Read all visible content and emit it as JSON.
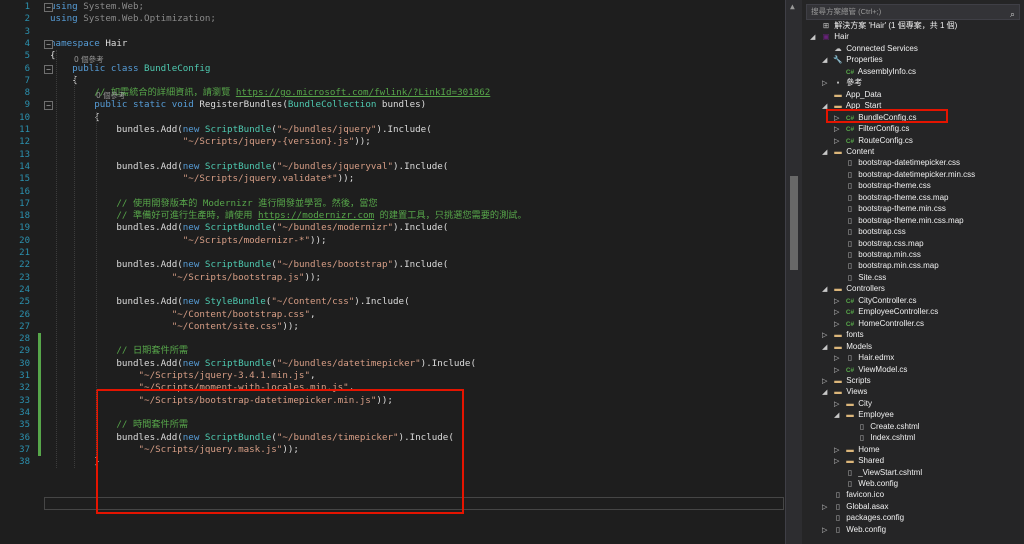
{
  "editor": {
    "line_numbers": [
      "1",
      "2",
      "3",
      "4",
      "5",
      "6",
      "7",
      "8",
      "9",
      "10",
      "11",
      "12",
      "13",
      "14",
      "15",
      "16",
      "17",
      "18",
      "19",
      "20",
      "21",
      "22",
      "23",
      "24",
      "25",
      "26",
      "27",
      "28",
      "29",
      "30",
      "31",
      "32",
      "33",
      "34",
      "35",
      "36",
      "37",
      "38"
    ],
    "references_label": "0 個參考",
    "lines": [
      [
        [
          "kw",
          "using "
        ],
        [
          "t",
          "System.Web;"
        ]
      ],
      [
        [
          "kw",
          "using "
        ],
        [
          "t",
          "System.Web.Optimization;"
        ]
      ],
      [],
      [
        [
          "kw",
          "namespace "
        ],
        [
          "t",
          "Hair"
        ]
      ],
      [
        [
          "t",
          "{"
        ]
      ],
      [
        [
          "kw",
          "    public class "
        ],
        [
          "type",
          "BundleConfig"
        ]
      ],
      [
        [
          "t",
          "    {"
        ]
      ],
      [
        [
          "cm",
          "        // 如需統合的詳細資訊，請瀏覽 "
        ],
        [
          "link",
          "https://go.microsoft.com/fwlink/?LinkId=301862"
        ]
      ],
      [
        [
          "kw",
          "        public static void "
        ],
        [
          "t",
          "RegisterBundles("
        ],
        [
          "type",
          "BundleCollection"
        ],
        [
          "t",
          " bundles)"
        ]
      ],
      [
        [
          "t",
          "        {"
        ]
      ],
      [
        [
          "t",
          "            bundles.Add("
        ],
        [
          "kw",
          "new "
        ],
        [
          "type",
          "ScriptBundle"
        ],
        [
          "t",
          "("
        ],
        [
          "str",
          "\"~/bundles/jquery\""
        ],
        [
          "t",
          ").Include("
        ]
      ],
      [
        [
          "str",
          "                        \"~/Scripts/jquery-{version}.js\""
        ],
        [
          "t",
          "));"
        ]
      ],
      [],
      [
        [
          "t",
          "            bundles.Add("
        ],
        [
          "kw",
          "new "
        ],
        [
          "type",
          "ScriptBundle"
        ],
        [
          "t",
          "("
        ],
        [
          "str",
          "\"~/bundles/jqueryval\""
        ],
        [
          "t",
          ").Include("
        ]
      ],
      [
        [
          "str",
          "                        \"~/Scripts/jquery.validate*\""
        ],
        [
          "t",
          "));"
        ]
      ],
      [],
      [
        [
          "cm",
          "            // 使用開發版本的 Modernizr 進行開發並學習。然後，當您"
        ]
      ],
      [
        [
          "cm",
          "            // 準備好可進行生產時，請使用 "
        ],
        [
          "link",
          "https://modernizr.com"
        ],
        [
          "cm",
          " 的建置工具，只挑選您需要的測試。"
        ]
      ],
      [
        [
          "t",
          "            bundles.Add("
        ],
        [
          "kw",
          "new "
        ],
        [
          "type",
          "ScriptBundle"
        ],
        [
          "t",
          "("
        ],
        [
          "str",
          "\"~/bundles/modernizr\""
        ],
        [
          "t",
          ").Include("
        ]
      ],
      [
        [
          "str",
          "                        \"~/Scripts/modernizr-*\""
        ],
        [
          "t",
          "));"
        ]
      ],
      [],
      [
        [
          "t",
          "            bundles.Add("
        ],
        [
          "kw",
          "new "
        ],
        [
          "type",
          "ScriptBundle"
        ],
        [
          "t",
          "("
        ],
        [
          "str",
          "\"~/bundles/bootstrap\""
        ],
        [
          "t",
          ").Include("
        ]
      ],
      [
        [
          "str",
          "                      \"~/Scripts/bootstrap.js\""
        ],
        [
          "t",
          "));"
        ]
      ],
      [],
      [
        [
          "t",
          "            bundles.Add("
        ],
        [
          "kw",
          "new "
        ],
        [
          "type",
          "StyleBundle"
        ],
        [
          "t",
          "("
        ],
        [
          "str",
          "\"~/Content/css\""
        ],
        [
          "t",
          ").Include("
        ]
      ],
      [
        [
          "str",
          "                      \"~/Content/bootstrap.css\""
        ],
        [
          "t",
          ","
        ]
      ],
      [
        [
          "str",
          "                      \"~/Content/site.css\""
        ],
        [
          "t",
          "));"
        ]
      ],
      [],
      [
        [
          "cm",
          "            // 日期套件所需"
        ]
      ],
      [
        [
          "t",
          "            bundles.Add("
        ],
        [
          "kw",
          "new "
        ],
        [
          "type",
          "ScriptBundle"
        ],
        [
          "t",
          "("
        ],
        [
          "str",
          "\"~/bundles/datetimepicker\""
        ],
        [
          "t",
          ").Include("
        ]
      ],
      [
        [
          "str",
          "                \"~/Scripts/jquery-3.4.1.min.js\""
        ],
        [
          "t",
          ","
        ]
      ],
      [
        [
          "str",
          "                \"~/Scripts/moment-with-locales.min.js\""
        ],
        [
          "t",
          ","
        ]
      ],
      [
        [
          "str",
          "                \"~/Scripts/bootstrap-datetimepicker.min.js\""
        ],
        [
          "t",
          "));"
        ]
      ],
      [],
      [
        [
          "cm",
          "            // 時間套件所需"
        ]
      ],
      [
        [
          "t",
          "            bundles.Add("
        ],
        [
          "kw",
          "new "
        ],
        [
          "type",
          "ScriptBundle"
        ],
        [
          "t",
          "("
        ],
        [
          "str",
          "\"~/bundles/timepicker\""
        ],
        [
          "t",
          ").Include("
        ]
      ],
      [
        [
          "str",
          "                \"~/Scripts/jquery.mask.js\""
        ],
        [
          "t",
          "));"
        ]
      ],
      [
        [
          "t",
          "        }"
        ]
      ]
    ]
  },
  "solution_explorer": {
    "search_placeholder": "搜尋方案總管 (Ctrl+;)",
    "items": [
      {
        "label": "解決方案 'Hair' (1 個專案，共 1 個)",
        "level": 0,
        "arrow": "",
        "icon": "sln"
      },
      {
        "label": "Hair",
        "level": 0,
        "arrow": "open",
        "icon": "proj"
      },
      {
        "label": "Connected Services",
        "level": 1,
        "arrow": "",
        "icon": "svc"
      },
      {
        "label": "Properties",
        "level": 1,
        "arrow": "open",
        "icon": "wrench"
      },
      {
        "label": "AssemblyInfo.cs",
        "level": 2,
        "arrow": "",
        "icon": "cs"
      },
      {
        "label": "參考",
        "level": 1,
        "arrow": "closed",
        "icon": "ref"
      },
      {
        "label": "App_Data",
        "level": 1,
        "arrow": "",
        "icon": "folder"
      },
      {
        "label": "App_Start",
        "level": 1,
        "arrow": "open",
        "icon": "folder"
      },
      {
        "label": "BundleConfig.cs",
        "level": 2,
        "arrow": "closed",
        "icon": "cs"
      },
      {
        "label": "FilterConfig.cs",
        "level": 2,
        "arrow": "closed",
        "icon": "cs"
      },
      {
        "label": "RouteConfig.cs",
        "level": 2,
        "arrow": "closed",
        "icon": "cs"
      },
      {
        "label": "Content",
        "level": 1,
        "arrow": "open",
        "icon": "folder"
      },
      {
        "label": "bootstrap-datetimepicker.css",
        "level": 2,
        "arrow": "",
        "icon": "file"
      },
      {
        "label": "bootstrap-datetimepicker.min.css",
        "level": 2,
        "arrow": "",
        "icon": "file"
      },
      {
        "label": "bootstrap-theme.css",
        "level": 2,
        "arrow": "",
        "icon": "file"
      },
      {
        "label": "bootstrap-theme.css.map",
        "level": 2,
        "arrow": "",
        "icon": "file"
      },
      {
        "label": "bootstrap-theme.min.css",
        "level": 2,
        "arrow": "",
        "icon": "file"
      },
      {
        "label": "bootstrap-theme.min.css.map",
        "level": 2,
        "arrow": "",
        "icon": "file"
      },
      {
        "label": "bootstrap.css",
        "level": 2,
        "arrow": "",
        "icon": "file"
      },
      {
        "label": "bootstrap.css.map",
        "level": 2,
        "arrow": "",
        "icon": "file"
      },
      {
        "label": "bootstrap.min.css",
        "level": 2,
        "arrow": "",
        "icon": "file"
      },
      {
        "label": "bootstrap.min.css.map",
        "level": 2,
        "arrow": "",
        "icon": "file"
      },
      {
        "label": "Site.css",
        "level": 2,
        "arrow": "",
        "icon": "file"
      },
      {
        "label": "Controllers",
        "level": 1,
        "arrow": "open",
        "icon": "folder"
      },
      {
        "label": "CityController.cs",
        "level": 2,
        "arrow": "closed",
        "icon": "cs"
      },
      {
        "label": "EmployeeController.cs",
        "level": 2,
        "arrow": "closed",
        "icon": "cs"
      },
      {
        "label": "HomeController.cs",
        "level": 2,
        "arrow": "closed",
        "icon": "cs"
      },
      {
        "label": "fonts",
        "level": 1,
        "arrow": "closed",
        "icon": "folder"
      },
      {
        "label": "Models",
        "level": 1,
        "arrow": "open",
        "icon": "folder"
      },
      {
        "label": "Hair.edmx",
        "level": 2,
        "arrow": "closed",
        "icon": "file"
      },
      {
        "label": "ViewModel.cs",
        "level": 2,
        "arrow": "closed",
        "icon": "cs"
      },
      {
        "label": "Scripts",
        "level": 1,
        "arrow": "closed",
        "icon": "folder"
      },
      {
        "label": "Views",
        "level": 1,
        "arrow": "open",
        "icon": "folder"
      },
      {
        "label": "City",
        "level": 2,
        "arrow": "closed",
        "icon": "folder"
      },
      {
        "label": "Employee",
        "level": 2,
        "arrow": "open",
        "icon": "folder"
      },
      {
        "label": "Create.cshtml",
        "level": 3,
        "arrow": "",
        "icon": "file"
      },
      {
        "label": "Index.cshtml",
        "level": 3,
        "arrow": "",
        "icon": "file"
      },
      {
        "label": "Home",
        "level": 2,
        "arrow": "closed",
        "icon": "folder"
      },
      {
        "label": "Shared",
        "level": 2,
        "arrow": "closed",
        "icon": "folder"
      },
      {
        "label": "_ViewStart.cshtml",
        "level": 2,
        "arrow": "",
        "icon": "file"
      },
      {
        "label": "Web.config",
        "level": 2,
        "arrow": "",
        "icon": "file"
      },
      {
        "label": "favicon.ico",
        "level": 1,
        "arrow": "",
        "icon": "file"
      },
      {
        "label": "Global.asax",
        "level": 1,
        "arrow": "closed",
        "icon": "file"
      },
      {
        "label": "packages.config",
        "level": 1,
        "arrow": "",
        "icon": "file"
      },
      {
        "label": "Web.config",
        "level": 1,
        "arrow": "closed",
        "icon": "file"
      }
    ]
  }
}
